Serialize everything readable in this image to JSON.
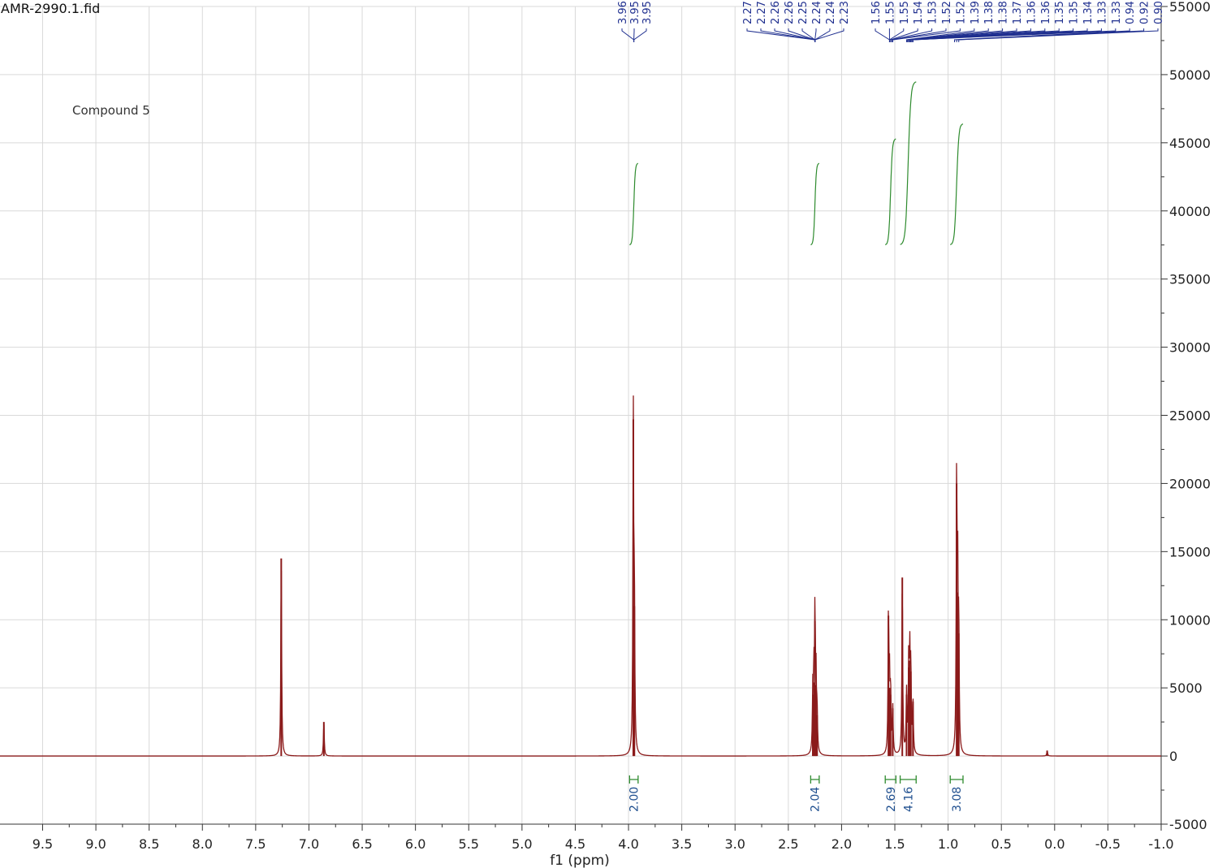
{
  "file_title": "AMR-2990.1.fid",
  "chart_data": {
    "type": "line",
    "title": "",
    "annotation": "Compound 5",
    "xlabel": "f1 (ppm)",
    "ylabel": "",
    "xlim": [
      9.9,
      -1.0
    ],
    "ylim": [
      -5000,
      55000
    ],
    "x_ticks": [
      "9.5",
      "9.0",
      "8.5",
      "8.0",
      "7.5",
      "7.0",
      "6.5",
      "6.0",
      "5.5",
      "5.0",
      "4.5",
      "4.0",
      "3.5",
      "3.0",
      "2.5",
      "2.0",
      "1.5",
      "1.0",
      "0.5",
      "0.0",
      "-0.5",
      "-1.0"
    ],
    "y_ticks": [
      "-5000",
      "0",
      "5000",
      "10000",
      "15000",
      "20000",
      "25000",
      "30000",
      "35000",
      "40000",
      "45000",
      "50000",
      "55000"
    ],
    "grid": true,
    "line_color": "#8b1a1a",
    "integral_color": "#2e8b2e",
    "peak_label_color": "#1f2f8f",
    "series": [
      {
        "peaks": [
          {
            "ppm": 7.26,
            "height": 14500
          },
          {
            "ppm": 6.86,
            "height": 2500
          },
          {
            "ppm": 3.955,
            "height": 24700
          },
          {
            "ppm": 3.945,
            "height": 11000
          },
          {
            "ppm": 2.27,
            "height": 4500
          },
          {
            "ppm": 2.26,
            "height": 5400
          },
          {
            "ppm": 2.25,
            "height": 9900
          },
          {
            "ppm": 2.24,
            "height": 5200
          },
          {
            "ppm": 2.23,
            "height": 3000
          },
          {
            "ppm": 1.56,
            "height": 10300
          },
          {
            "ppm": 1.55,
            "height": 5000
          },
          {
            "ppm": 1.54,
            "height": 4500
          },
          {
            "ppm": 1.52,
            "height": 3500
          },
          {
            "ppm": 1.43,
            "height": 13100
          },
          {
            "ppm": 1.39,
            "height": 4500
          },
          {
            "ppm": 1.37,
            "height": 6500
          },
          {
            "ppm": 1.36,
            "height": 7000
          },
          {
            "ppm": 1.35,
            "height": 6200
          },
          {
            "ppm": 1.33,
            "height": 4000
          },
          {
            "ppm": 0.92,
            "height": 20000
          },
          {
            "ppm": 0.91,
            "height": 12000
          },
          {
            "ppm": 0.9,
            "height": 9000
          },
          {
            "ppm": 0.07,
            "height": 400
          }
        ]
      }
    ],
    "peak_label_groups": [
      {
        "labels": [
          "3.96",
          "3.95",
          "3.95"
        ],
        "target_ppm": 3.95
      },
      {
        "labels": [
          "2.27",
          "2.27",
          "2.26",
          "2.26",
          "2.25",
          "2.24",
          "2.24",
          "2.23"
        ],
        "target_ppm": 2.25
      },
      {
        "labels": [
          "1.56",
          "1.55",
          "1.55",
          "1.54",
          "1.53",
          "1.52",
          "1.52",
          "1.39",
          "1.38",
          "1.38",
          "1.37",
          "1.36",
          "1.36",
          "1.35",
          "1.35",
          "1.34",
          "1.33",
          "1.33",
          "0.94",
          "0.92",
          "0.90"
        ],
        "target_ppm": [
          1.55,
          1.55,
          1.55,
          1.54,
          1.53,
          1.52,
          1.52,
          1.39,
          1.38,
          1.38,
          1.37,
          1.36,
          1.36,
          1.35,
          1.35,
          1.34,
          1.33,
          1.33,
          0.94,
          0.92,
          0.9
        ]
      }
    ],
    "integrals": [
      {
        "from": 3.99,
        "to": 3.91,
        "value": "2.00",
        "curve_rise": 6000
      },
      {
        "from": 2.29,
        "to": 2.21,
        "value": "2.04",
        "curve_rise": 6000
      },
      {
        "from": 1.59,
        "to": 1.49,
        "value": "2.69",
        "curve_rise": 7800
      },
      {
        "from": 1.45,
        "to": 1.3,
        "value": "4.16",
        "curve_rise": 12000
      },
      {
        "from": 0.98,
        "to": 0.86,
        "value": "3.08",
        "curve_rise": 8900
      }
    ]
  }
}
